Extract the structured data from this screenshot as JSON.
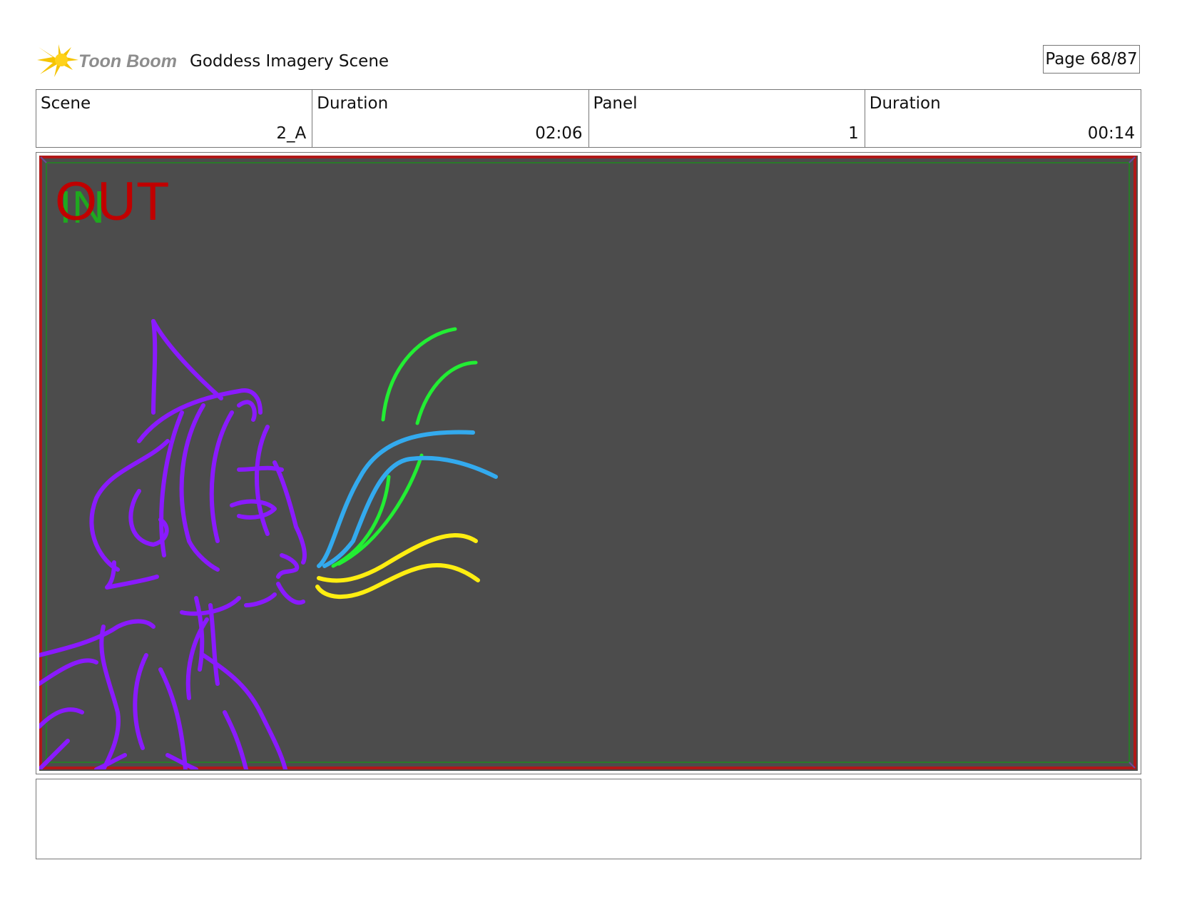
{
  "header": {
    "logo_text": "Toon Boom",
    "project_title": "Goddess Imagery Scene",
    "page_label": "Page 68/87"
  },
  "info": {
    "scene_label": "Scene",
    "scene_value": "2_A",
    "scene_duration_label": "Duration",
    "scene_duration_value": "02:06",
    "panel_label": "Panel",
    "panel_value": "1",
    "panel_duration_label": "Duration",
    "panel_duration_value": "00:14"
  },
  "panel": {
    "in_label": "IN",
    "out_label": "OUT",
    "in_color": "#1fa81f",
    "out_color": "#c00000",
    "background_color": "#4c4c4c",
    "figure_color": "#8a1aff",
    "stroke_colors": [
      "#22ee33",
      "#33aaee",
      "#ffee11"
    ]
  },
  "notes": {
    "text": ""
  }
}
